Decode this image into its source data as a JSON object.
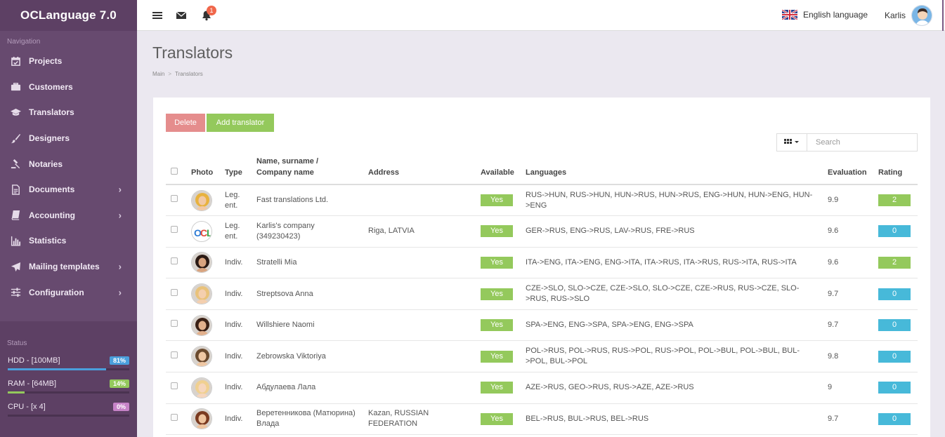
{
  "app": {
    "brand": "OCLanguage 7.0"
  },
  "sidebar": {
    "nav_heading": "Navigation",
    "items": [
      {
        "label": "Projects",
        "icon": "calendar-check-icon",
        "has_children": false
      },
      {
        "label": "Customers",
        "icon": "briefcase-icon",
        "has_children": false
      },
      {
        "label": "Translators",
        "icon": "graduation-cap-icon",
        "has_children": false
      },
      {
        "label": "Designers",
        "icon": "paint-brush-icon",
        "has_children": false
      },
      {
        "label": "Notaries",
        "icon": "gavel-icon",
        "has_children": false
      },
      {
        "label": "Documents",
        "icon": "file-text-icon",
        "has_children": true
      },
      {
        "label": "Accounting",
        "icon": "book-icon",
        "has_children": true
      },
      {
        "label": "Statistics",
        "icon": "bar-chart-icon",
        "has_children": false
      },
      {
        "label": "Mailing templates",
        "icon": "paper-plane-icon",
        "has_children": true
      },
      {
        "label": "Configuration",
        "icon": "sliders-icon",
        "has_children": true
      }
    ],
    "status_heading": "Status",
    "status": [
      {
        "label": "HDD - [100MB]",
        "percent_label": "81%",
        "percent": 81,
        "color": "#4a9fdc"
      },
      {
        "label": "RAM - [64MB]",
        "percent_label": "14%",
        "percent": 14,
        "color": "#94c95c"
      },
      {
        "label": "CPU - [x 4]",
        "percent_label": "0%",
        "percent": 0,
        "color": "#c783c8"
      }
    ]
  },
  "topbar": {
    "notifications_count": "1",
    "language": "English language",
    "user_name": "Karlis"
  },
  "page": {
    "title": "Translators",
    "breadcrumb": [
      "Main",
      "Translators"
    ]
  },
  "toolbar": {
    "delete_label": "Delete",
    "add_label": "Add translator",
    "search_placeholder": "Search"
  },
  "table": {
    "headers": {
      "photo": "Photo",
      "type": "Type",
      "name_line1": "Name, surname /",
      "name_line2": "Company name",
      "address": "Address",
      "available": "Available",
      "languages": "Languages",
      "evaluation": "Evaluation",
      "rating": "Rating"
    },
    "rows": [
      {
        "type": "Leg. ent.",
        "name": "Fast translations Ltd.",
        "address": "",
        "available": "Yes",
        "languages": "RUS->HUN, RUS->HUN, HUN->RUS, HUN->RUS, ENG->HUN, HUN->ENG, HUN->ENG",
        "evaluation": "9.9",
        "rating": "2",
        "rating_color": "#94c95c"
      },
      {
        "type": "Leg. ent.",
        "name": "Karlis's company (349230423)",
        "address": "Riga, LATVIA",
        "available": "Yes",
        "languages": "GER->RUS, ENG->RUS, LAV->RUS, FRE->RUS",
        "evaluation": "9.6",
        "rating": "0",
        "rating_color": "#47b9d9"
      },
      {
        "type": "Indiv.",
        "name": "Stratelli Mia",
        "address": "",
        "available": "Yes",
        "languages": "ITA->ENG, ITA->ENG, ENG->ITA, ITA->RUS, ITA->RUS, RUS->ITA, RUS->ITA",
        "evaluation": "9.6",
        "rating": "2",
        "rating_color": "#94c95c"
      },
      {
        "type": "Indiv.",
        "name": "Streptsova Anna",
        "address": "",
        "available": "Yes",
        "languages": "CZE->SLO, SLO->CZE, CZE->SLO, SLO->CZE, CZE->RUS, RUS->CZE, SLO->RUS, RUS->SLO",
        "evaluation": "9.7",
        "rating": "0",
        "rating_color": "#47b9d9"
      },
      {
        "type": "Indiv.",
        "name": "Willshiere Naomi",
        "address": "",
        "available": "Yes",
        "languages": "SPA->ENG, ENG->SPA, SPA->ENG, ENG->SPA",
        "evaluation": "9.7",
        "rating": "0",
        "rating_color": "#47b9d9"
      },
      {
        "type": "Indiv.",
        "name": "Zebrowska Viktoriya",
        "address": "",
        "available": "Yes",
        "languages": "POL->RUS, POL->RUS, RUS->POL, RUS->POL, POL->BUL, POL->BUL, BUL->POL, BUL->POL",
        "evaluation": "9.8",
        "rating": "0",
        "rating_color": "#47b9d9"
      },
      {
        "type": "Indiv.",
        "name": "Абдулаева Лала",
        "address": "",
        "available": "Yes",
        "languages": "AZE->RUS, GEO->RUS, RUS->AZE, AZE->RUS",
        "evaluation": "9",
        "rating": "0",
        "rating_color": "#47b9d9"
      },
      {
        "type": "Indiv.",
        "name": "Веретенникова (Матюрина) Влада",
        "address": "Kazan, RUSSIAN FEDERATION",
        "available": "Yes",
        "languages": "BEL->RUS, BUL->RUS, BEL->RUS",
        "evaluation": "9.7",
        "rating": "0",
        "rating_color": "#47b9d9"
      }
    ]
  }
}
